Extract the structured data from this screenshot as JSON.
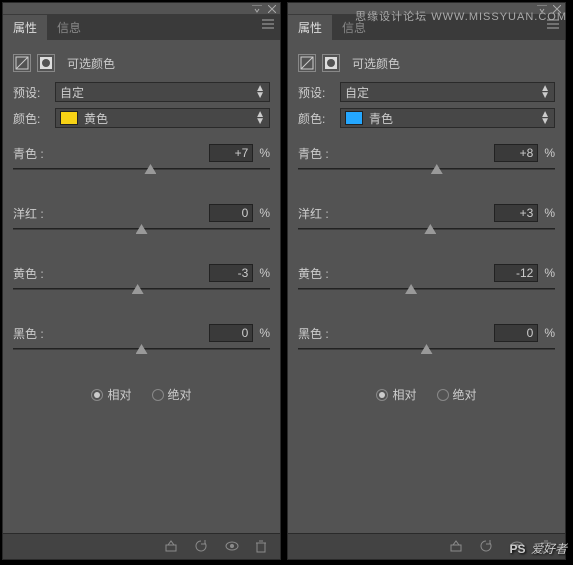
{
  "watermark_top": "思缘设计论坛  WWW.MISSYUAN.COM",
  "watermark_bottom": "PS 爱好者",
  "tabs": {
    "properties": "属性",
    "info": "信息"
  },
  "title": "可选颜色",
  "labels": {
    "preset": "预设:",
    "colors": "颜色:",
    "cyan": "青色 :",
    "magenta": "洋红 :",
    "yellow": "黄色 :",
    "black": "黑色 :",
    "relative": "相对",
    "absolute": "绝对",
    "percent": "%",
    "custom": "自定"
  },
  "panels": [
    {
      "preset": "自定",
      "swatch": "#f7d215",
      "colorName": "黄色",
      "values": {
        "cyan": "+7",
        "magenta": "0",
        "yellow": "-3",
        "black": "0"
      },
      "mode": "relative"
    },
    {
      "preset": "自定",
      "swatch": "#24a7ff",
      "colorName": "青色",
      "values": {
        "cyan": "+8",
        "magenta": "+3",
        "yellow": "-12",
        "black": "0"
      },
      "mode": "relative"
    }
  ]
}
